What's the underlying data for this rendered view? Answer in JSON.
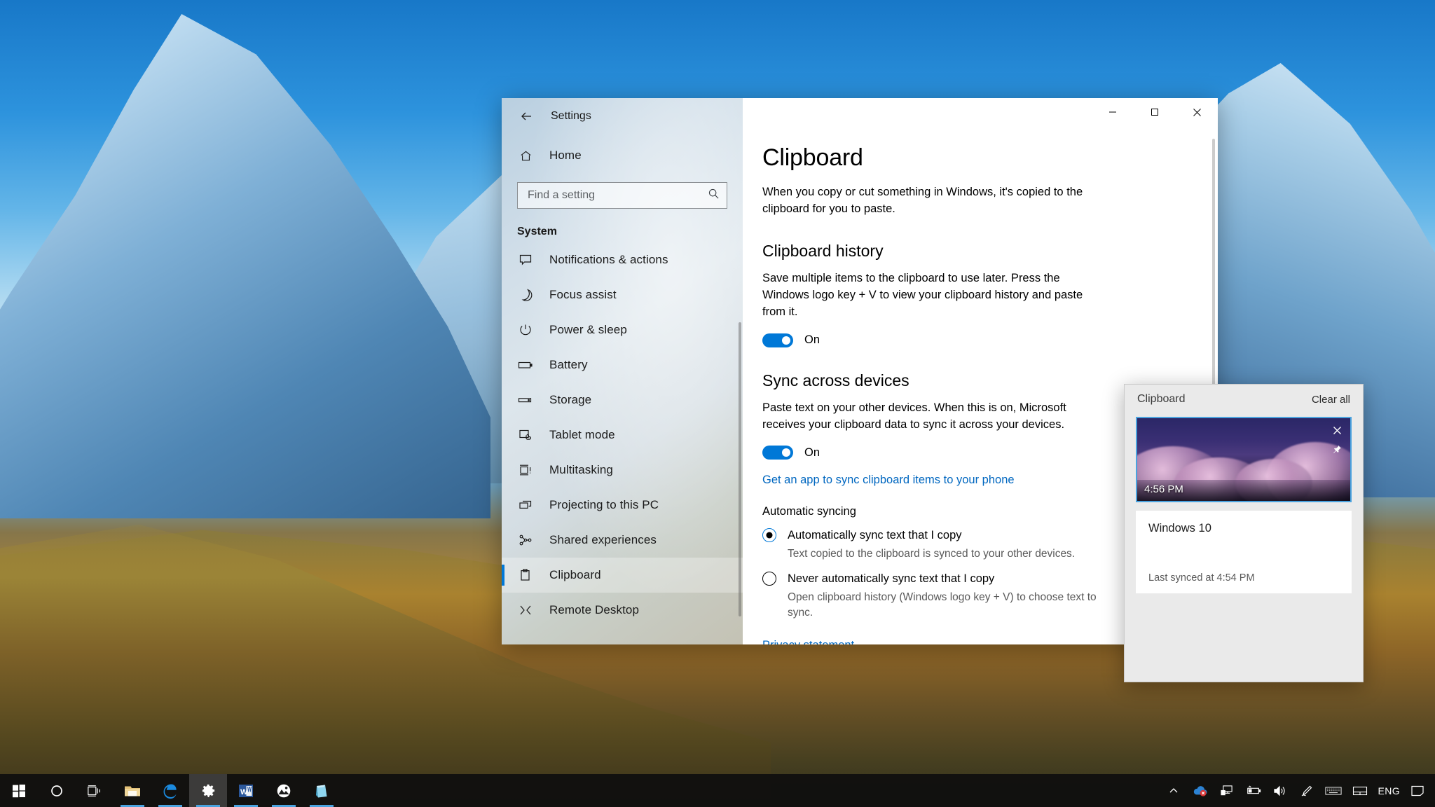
{
  "window": {
    "app_title": "Settings",
    "back_icon": "back-arrow-icon",
    "minimize_label": "–",
    "maximize_label": "□",
    "close_label": "✕"
  },
  "sidebar": {
    "home_label": "Home",
    "search_placeholder": "Find a setting",
    "search_value": "",
    "group_title": "System",
    "items": [
      {
        "label": "Notifications & actions",
        "icon": "notification-icon",
        "selected": false
      },
      {
        "label": "Focus assist",
        "icon": "moon-icon",
        "selected": false
      },
      {
        "label": "Power & sleep",
        "icon": "power-icon",
        "selected": false
      },
      {
        "label": "Battery",
        "icon": "battery-icon",
        "selected": false
      },
      {
        "label": "Storage",
        "icon": "storage-icon",
        "selected": false
      },
      {
        "label": "Tablet mode",
        "icon": "tablet-icon",
        "selected": false
      },
      {
        "label": "Multitasking",
        "icon": "multitasking-icon",
        "selected": false
      },
      {
        "label": "Projecting to this PC",
        "icon": "projecting-icon",
        "selected": false
      },
      {
        "label": "Shared experiences",
        "icon": "shared-icon",
        "selected": false
      },
      {
        "label": "Clipboard",
        "icon": "clipboard-icon",
        "selected": true
      },
      {
        "label": "Remote Desktop",
        "icon": "remote-desktop-icon",
        "selected": false
      }
    ]
  },
  "main": {
    "page_title": "Clipboard",
    "intro": "When you copy or cut something in Windows, it's copied to the clipboard for you to paste.",
    "history": {
      "heading": "Clipboard history",
      "description": "Save multiple items to the clipboard to use later. Press the Windows logo key + V to view your clipboard history and paste from it.",
      "toggle_state": "On"
    },
    "sync": {
      "heading": "Sync across devices",
      "description": "Paste text on your other devices. When this is on, Microsoft receives your clipboard data to sync it across your devices.",
      "toggle_state": "On",
      "app_link": "Get an app to sync clipboard items to your phone",
      "auto_label": "Automatic syncing",
      "options": [
        {
          "label": "Automatically sync text that I copy",
          "description": "Text copied to the clipboard is synced to your other devices.",
          "checked": true
        },
        {
          "label": "Never automatically sync text that I copy",
          "description": "Open clipboard history (Windows logo key + V) to choose text to sync.",
          "checked": false
        }
      ],
      "privacy_link": "Privacy statement"
    }
  },
  "clipboard_flyout": {
    "title": "Clipboard",
    "clear_all_label": "Clear all",
    "image_item": {
      "timestamp": "4:56 PM",
      "close_icon": "close-icon",
      "pin_icon": "pin-icon"
    },
    "text_item": {
      "text": "Windows 10",
      "sub": "Last synced at 4:54 PM"
    }
  },
  "taskbar": {
    "left_items": [
      {
        "name": "start-button",
        "icon": "windows-logo-icon"
      },
      {
        "name": "cortana-button",
        "icon": "circle-icon"
      },
      {
        "name": "task-view-button",
        "icon": "task-view-icon"
      },
      {
        "name": "file-explorer-button",
        "icon": "folder-icon"
      },
      {
        "name": "edge-button",
        "icon": "edge-icon"
      },
      {
        "name": "settings-button",
        "icon": "gear-icon"
      },
      {
        "name": "word-button",
        "icon": "word-icon"
      },
      {
        "name": "photos-button",
        "icon": "photos-icon"
      },
      {
        "name": "store-button",
        "icon": "store-icon"
      }
    ],
    "tray_items": [
      {
        "name": "show-hidden-icons-button",
        "icon": "chevron-up-icon"
      },
      {
        "name": "onedrive-status-icon",
        "icon": "onedrive-error-icon"
      },
      {
        "name": "network-icon",
        "icon": "ethernet-icon"
      },
      {
        "name": "battery-icon",
        "icon": "battery-tray-icon"
      },
      {
        "name": "volume-icon",
        "icon": "speaker-icon"
      },
      {
        "name": "pen-menu-icon",
        "icon": "pen-icon"
      },
      {
        "name": "touch-keyboard-button",
        "icon": "keyboard-icon"
      },
      {
        "name": "touchpad-icon",
        "icon": "touchpad-icon"
      }
    ],
    "language": "ENG",
    "action_center_icon": "action-center-icon"
  },
  "colors": {
    "accent": "#0078d7",
    "link": "#0067c0",
    "selection_border": "#4aa3df"
  }
}
